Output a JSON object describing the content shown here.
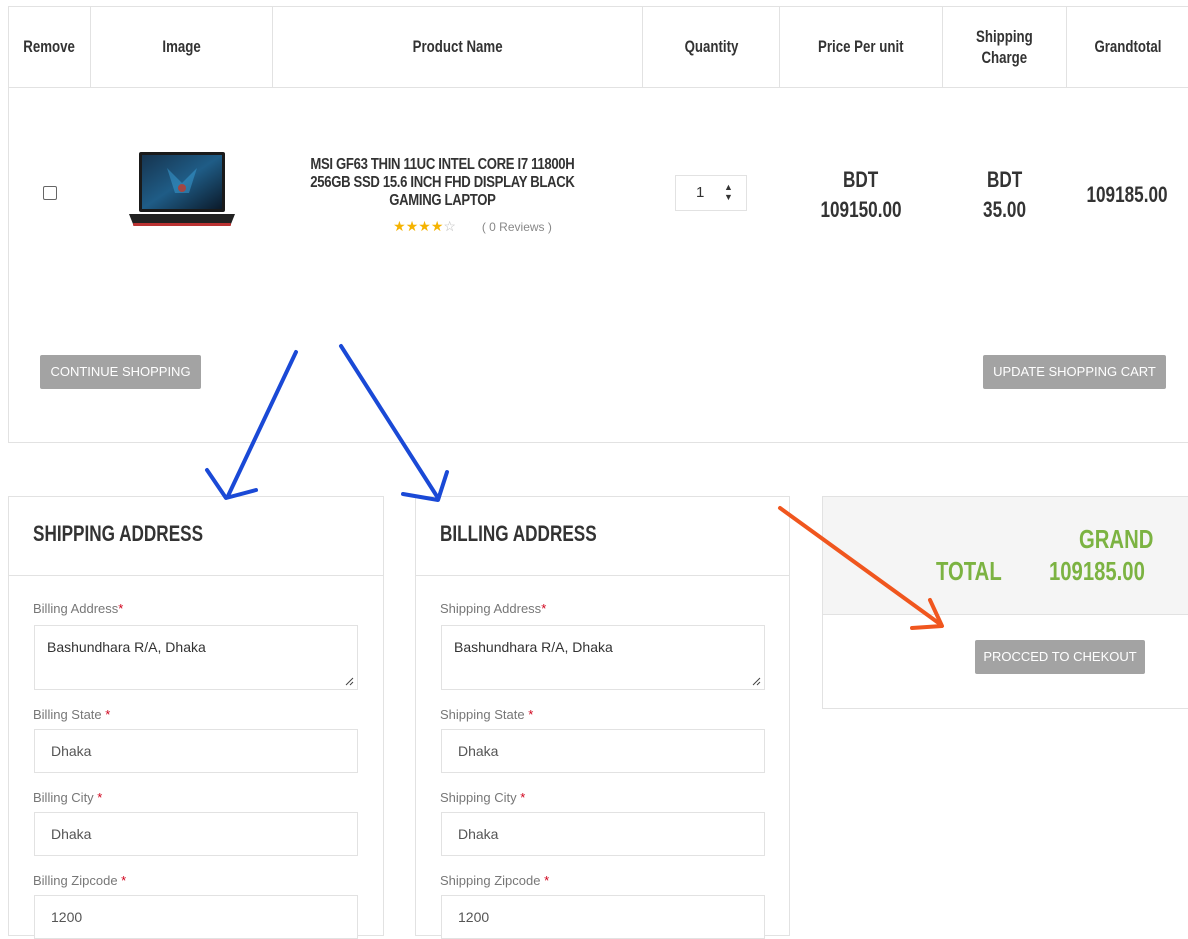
{
  "cart": {
    "headers": {
      "remove": "Remove",
      "image": "Image",
      "product_name": "Product Name",
      "quantity": "Quantity",
      "price_per_unit": "Price Per unit",
      "shipping_line1": "Shipping",
      "shipping_line2": "Charge",
      "grandtotal": "Grandtotal"
    },
    "row": {
      "product_title": "MSI GF63 THIN 11UC INTEL CORE I7 11800H 256GB SSD 15.6 INCH FHD DISPLAY BLACK GAMING LAPTOP",
      "rating": 4,
      "rating_max": 5,
      "reviews": "( 0 Reviews )",
      "quantity": "1",
      "price_currency": "BDT",
      "price_value": "109150.00",
      "shipping_currency": "BDT",
      "shipping_value": "35.00",
      "grandtotal": "109185.00"
    },
    "continue_label": "CONTINUE SHOPPING",
    "update_label": "UPDATE SHOPPING CART"
  },
  "shipping_panel": {
    "title": "SHIPPING ADDRESS",
    "address_label": "Billing Address",
    "address_value": "Bashundhara R/A, Dhaka",
    "state_label": "Billing State ",
    "state_value": "Dhaka",
    "city_label": "Billing City ",
    "city_value": "Dhaka",
    "zip_label": "Billing Zipcode ",
    "zip_value": "1200",
    "required_mark": "*"
  },
  "billing_panel": {
    "title": "BILLING ADDRESS",
    "address_label": "Shipping Address",
    "address_value": "Bashundhara R/A, Dhaka",
    "state_label": "Shipping State ",
    "state_value": "Dhaka",
    "city_label": "Shipping City ",
    "city_value": "Dhaka",
    "zip_label": "Shipping Zipcode ",
    "zip_value": "1200",
    "required_mark": "*"
  },
  "totals": {
    "grand_label_1": "GRAND",
    "grand_label_2": "TOTAL",
    "grand_value": "109185.00",
    "checkout_label": "PROCCED TO CHEKOUT"
  },
  "colors": {
    "accent_green": "#7cb342",
    "button_gray": "#a3a3a3",
    "arrow_blue": "#1a49d6",
    "arrow_orange": "#f0561e",
    "required_red": "#d0021b",
    "star_gold": "#f5b301"
  }
}
